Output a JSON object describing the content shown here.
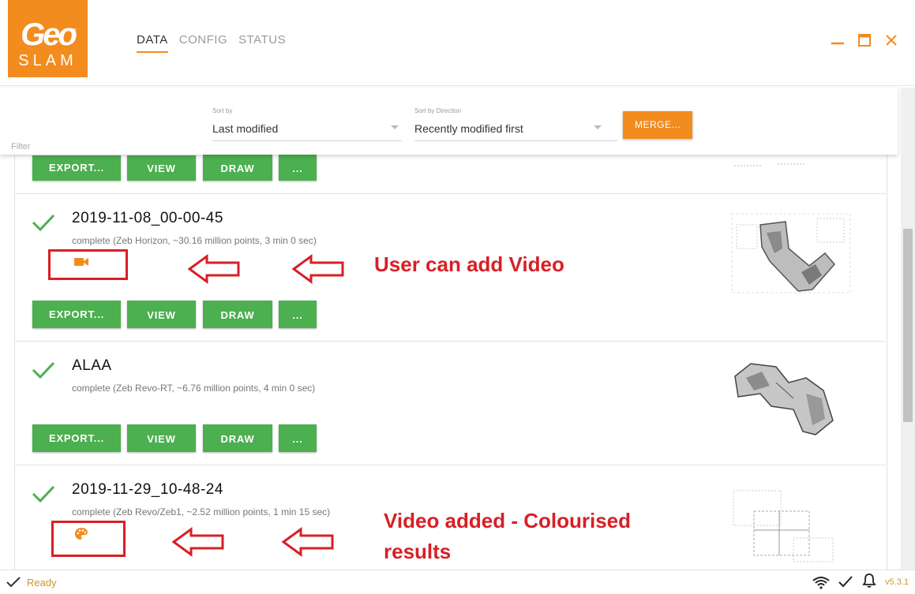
{
  "app": {
    "logo_top": "Geo",
    "logo_bottom": "SLAM",
    "logo_tm": "™",
    "brand_color": "#f28c1e"
  },
  "nav": {
    "tabs": [
      "DATA",
      "CONFIG",
      "STATUS"
    ],
    "active": "DATA"
  },
  "window_controls": [
    "minimize-icon",
    "maximize-icon",
    "close-icon"
  ],
  "filterbar": {
    "filter_placeholder": "Filter",
    "sort_by_label": "Sort by",
    "sort_by_value": "Last modified",
    "sort_dir_label": "Sort by Direction",
    "sort_dir_value": "Recently modified first",
    "merge_label": "MERGE..."
  },
  "actions": {
    "export": "EXPORT...",
    "view": "VIEW",
    "draw": "DRAW",
    "more": "..."
  },
  "items": [
    {
      "title": "2019-11-08_00-00-45",
      "subtitle": "complete (Zeb Horizon, ~30.16 million points, 3 min 0 sec)",
      "status_icon": "check-icon",
      "extra_icon": "video-camera-icon"
    },
    {
      "title": "ALAA",
      "subtitle": "complete (Zeb Revo-RT, ~6.76 million points, 4 min 0 sec)",
      "status_icon": "check-icon"
    },
    {
      "title": "2019-11-29_10-48-24",
      "subtitle": "complete (Zeb Revo/Zeb1, ~2.52 million points, 1 min 15 sec)",
      "status_icon": "check-icon",
      "extra_icon": "palette-icon"
    }
  ],
  "annotations": {
    "video": "User can add Video",
    "colourised_line1": "Video added - Colourised",
    "colourised_line2": "results",
    "color": "#d81f26"
  },
  "statusbar": {
    "status": "Ready",
    "version": "v5.3.1",
    "icons": [
      "wifi-icon",
      "check-icon",
      "bell-icon"
    ]
  }
}
